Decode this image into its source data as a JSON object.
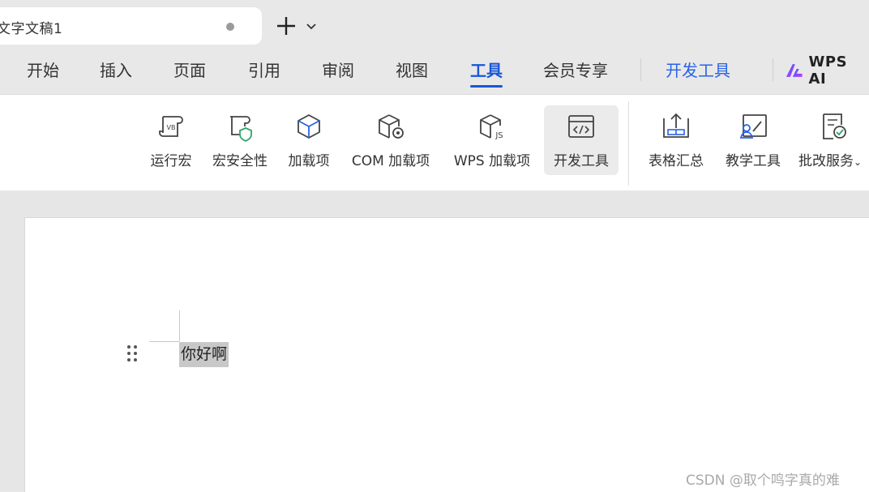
{
  "tab": {
    "document_title": "文字文稿1"
  },
  "menu": {
    "items": [
      "开始",
      "插入",
      "页面",
      "引用",
      "审阅",
      "视图",
      "工具",
      "会员专享"
    ],
    "active": "工具",
    "dev_tools": "开发工具",
    "wps_ai": "WPS AI"
  },
  "ribbon": {
    "tools": [
      {
        "label": "运行宏",
        "icon": "run-macro-icon"
      },
      {
        "label": "宏安全性",
        "icon": "macro-security-icon"
      },
      {
        "label": "加载项",
        "icon": "addin-icon"
      },
      {
        "label": "COM 加载项",
        "icon": "com-addin-icon"
      },
      {
        "label": "WPS 加载项",
        "icon": "wps-addin-icon"
      },
      {
        "label": "开发工具",
        "icon": "developer-tools-icon"
      },
      {
        "label": "表格汇总",
        "icon": "table-summary-icon"
      },
      {
        "label": "教学工具",
        "icon": "teaching-tools-icon"
      },
      {
        "label": "批改服务",
        "icon": "grading-service-icon"
      }
    ],
    "selected": "开发工具"
  },
  "document": {
    "paragraph": "你好啊"
  },
  "watermark": "CSDN @取个鸣字真的难",
  "colors": {
    "accent": "#1a56d6",
    "ribbon_bg": "#ffffff",
    "chrome_bg": "#e8e8e8",
    "selection": "#c8c8c8"
  }
}
